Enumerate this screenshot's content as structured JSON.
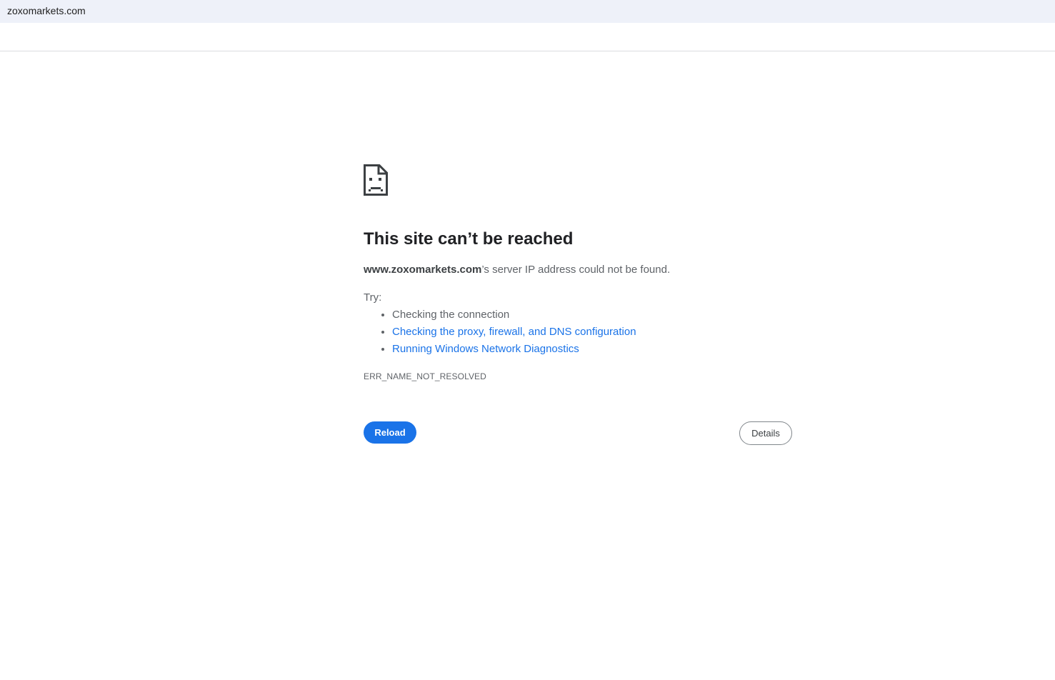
{
  "address_bar": {
    "url": "zoxomarkets.com"
  },
  "error_page": {
    "icon": "sad-page-icon",
    "headline": "This site can’t be reached",
    "summary": {
      "host": "www.zoxomarkets.com",
      "message": "’s server IP address could not be found."
    },
    "try_label": "Try:",
    "suggestions": [
      {
        "text": "Checking the connection",
        "is_link": false
      },
      {
        "text": "Checking the proxy, firewall, and DNS configuration",
        "is_link": true
      },
      {
        "text": "Running Windows Network Diagnostics",
        "is_link": true
      }
    ],
    "error_code": "ERR_NAME_NOT_RESOLVED",
    "reload_label": "Reload",
    "details_label": "Details"
  },
  "colors": {
    "accent": "#1a73e8",
    "text_primary": "#202124",
    "text_secondary": "#5f6368",
    "top_bar_bg": "#eef1f9"
  }
}
